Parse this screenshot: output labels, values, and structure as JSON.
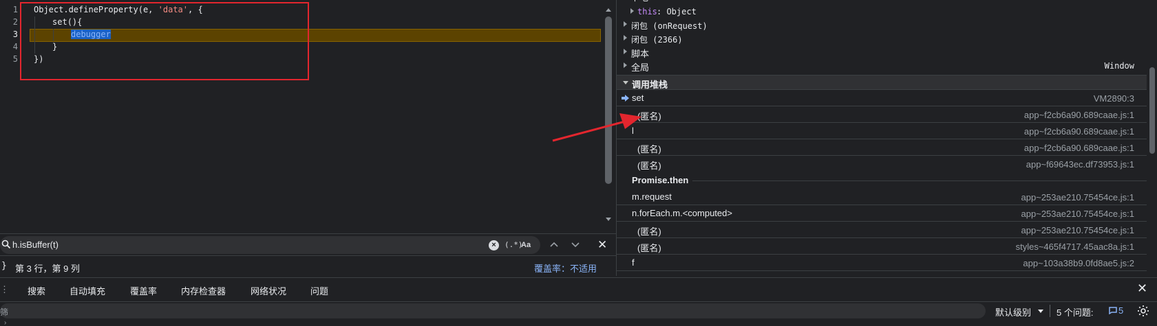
{
  "editor": {
    "lines": [
      {
        "num": "1",
        "text": "Object.defineProperty(e, 'data', {"
      },
      {
        "num": "2",
        "text": "set(){"
      },
      {
        "num": "3",
        "text": "debugger"
      },
      {
        "num": "4",
        "text": "}"
      },
      {
        "num": "5",
        "text": "})"
      }
    ],
    "code_tokens": {
      "obj": "Object.",
      "fn": "defineProperty",
      "args_open": "(e, ",
      "str": "'data'",
      "args_close": ", {",
      "set_kw": "set",
      "set_rest": "(){",
      "debugger_kw": "debugger",
      "close_brace": "}",
      "close_paren": "})"
    }
  },
  "search": {
    "query": "h.isBuffer(t)",
    "regex_label": "(.*)",
    "case_label": "Aa"
  },
  "status": {
    "brace": "}",
    "position": "第 3 行，第 9 列",
    "coverage": "覆盖率：不适用"
  },
  "scope": {
    "partial_top": "本地",
    "this_key": "this",
    "this_val": ": Object",
    "closure1": "闭包 (onRequest)",
    "closure2": "闭包 (2366)",
    "script": "脚本",
    "global": "全局",
    "global_val": "Window"
  },
  "callstack": {
    "title": "调用堆栈",
    "frames": [
      {
        "name": "set",
        "loc": "VM2890:3"
      },
      {
        "name": "(匿名)",
        "loc": "app~f2cb6a90.689caae.js:1"
      },
      {
        "name": "l",
        "loc": "app~f2cb6a90.689caae.js:1"
      },
      {
        "name": "(匿名)",
        "loc": "app~f2cb6a90.689caae.js:1"
      },
      {
        "name": "(匿名)",
        "loc": "app~f69643ec.df73953.js:1"
      }
    ],
    "async_label": "Promise.then",
    "frames2": [
      {
        "name": "m.request",
        "loc": "app~253ae210.75454ce.js:1"
      },
      {
        "name": "n.forEach.m.<computed>",
        "loc": "app~253ae210.75454ce.js:1"
      },
      {
        "name": "(匿名)",
        "loc": "app~253ae210.75454ce.js:1"
      },
      {
        "name": "(匿名)",
        "loc": "styles~465f4717.45aac8a.js:1"
      },
      {
        "name": "f",
        "loc": "app~103a38b9.0fd8ae5.js:2"
      }
    ]
  },
  "drawer": {
    "tabs": [
      "搜索",
      "自动填充",
      "覆盖率",
      "内存检查器",
      "网络状况",
      "问题"
    ],
    "filter_placeholder": "筛",
    "level": "默认级别",
    "issues_label": "5 个问题:",
    "issues_count": "5"
  },
  "colors": {
    "background": "#202124",
    "highlight": "#5c4300",
    "annotation_red": "#e3262e",
    "link_blue": "#8ab4f8"
  }
}
